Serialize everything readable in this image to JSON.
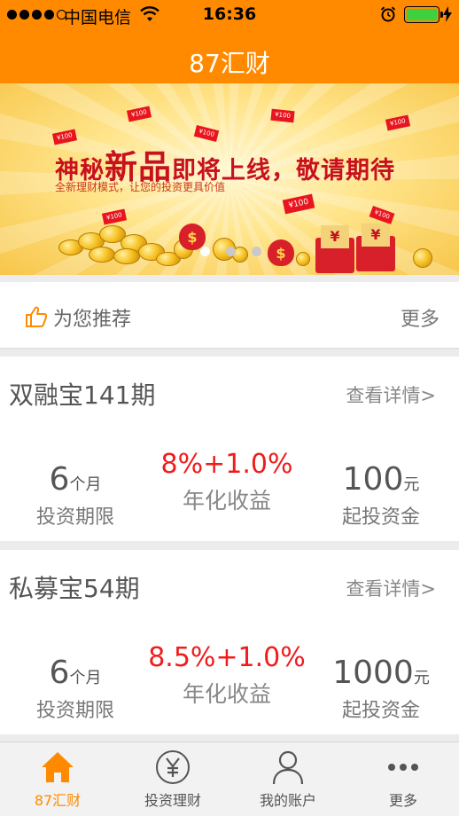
{
  "status_bar": {
    "carrier": "中国电信",
    "time": "16:36",
    "battery_level": 1.0
  },
  "nav": {
    "title": "87汇财"
  },
  "banner": {
    "headline_prefix": "神秘",
    "headline_big": "新品",
    "headline_suffix": "即将上线，敬请期待",
    "subline": "全新理财模式，让您的投资更具价值",
    "bill_text": "¥100",
    "slide_count": 3,
    "active_slide": 1
  },
  "recommend": {
    "label": "为您推荐",
    "more": "更多"
  },
  "products": [
    {
      "title": "双融宝141期",
      "detail_link": "查看详情>",
      "term_value": "6",
      "term_unit": "个月",
      "term_label": "投资期限",
      "rate": "8%+1.0%",
      "rate_label": "年化收益",
      "min_value": "100",
      "min_unit": "元",
      "min_label": "起投资金"
    },
    {
      "title": "私募宝54期",
      "detail_link": "查看详情>",
      "term_value": "6",
      "term_unit": "个月",
      "term_label": "投资期限",
      "rate": "8.5%+1.0%",
      "rate_label": "年化收益",
      "min_value": "1000",
      "min_unit": "元",
      "min_label": "起投资金"
    }
  ],
  "tabs": [
    {
      "label": "87汇财",
      "icon": "home-icon",
      "active": true
    },
    {
      "label": "投资理财",
      "icon": "yen-circle-icon",
      "active": false
    },
    {
      "label": "我的账户",
      "icon": "person-icon",
      "active": false
    },
    {
      "label": "更多",
      "icon": "more-dots-icon",
      "active": false
    }
  ],
  "colors": {
    "accent": "#ff8a00",
    "rate_red": "#f01c1c",
    "banner_red": "#c8101e"
  }
}
